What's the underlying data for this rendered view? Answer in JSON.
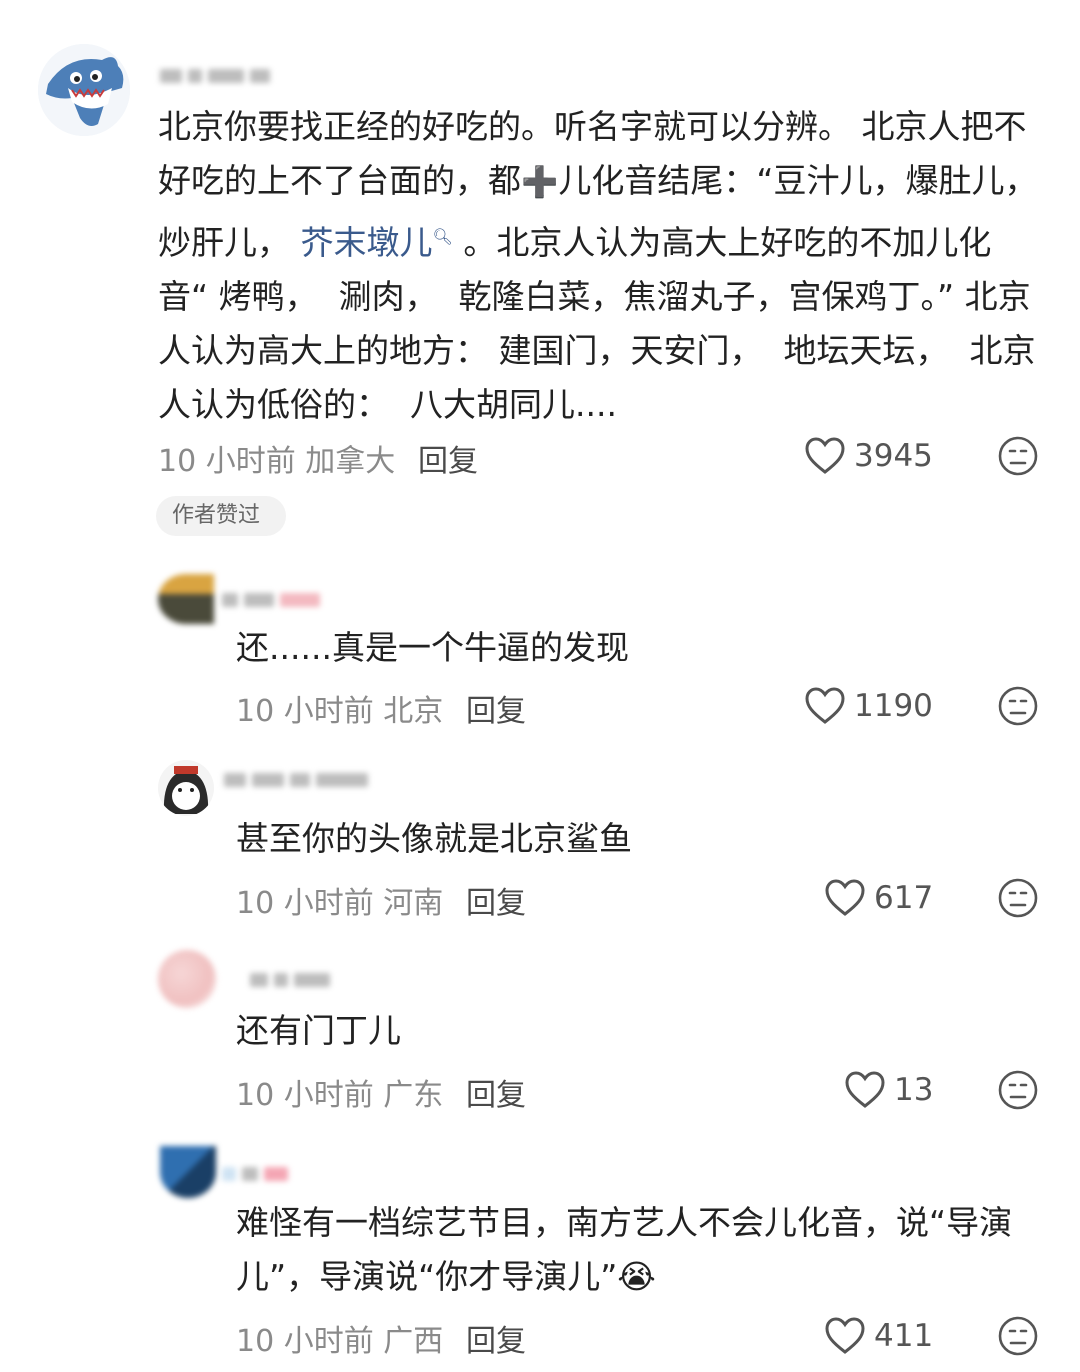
{
  "main_comment": {
    "author_name": "",
    "text_part1": "北京你要找正经的好吃的。听名字就可以分辨。 北京人把不好吃的上不了台面的，都",
    "plus_glyph": "➕",
    "text_part2": "儿化音结尾：“豆汁儿，爆肚儿，炒肝儿，",
    "link_text": "芥末墩儿",
    "text_part3": "。北京人认为高大上好吃的不加儿化音“ 烤鸭，  涮肉，  乾隆白菜，焦溜丸子，宫保鸡丁。” 北京人认为高大上的地方： 建国门，天安门，  地坛天坛，  北京人认为低俗的：  八大胡同儿....",
    "time": "10 小时前",
    "location": "加拿大",
    "reply_label": "回复",
    "likes": "3945",
    "badge": "作者赞过"
  },
  "replies": [
    {
      "text": "还......真是一个牛逼的发现",
      "time": "10 小时前",
      "location": "北京",
      "reply_label": "回复",
      "likes": "1190"
    },
    {
      "text": "甚至你的头像就是北京鲨鱼",
      "time": "10 小时前",
      "location": "河南",
      "reply_label": "回复",
      "likes": "617"
    },
    {
      "text": "还有门丁儿",
      "time": "10 小时前",
      "location": "广东",
      "reply_label": "回复",
      "likes": "13"
    },
    {
      "text": "难怪有一档综艺节目，南方艺人不会儿化音，说“导演儿”，导演说“你才导演儿”",
      "emoji": "😭",
      "time": "10 小时前",
      "location": "广西",
      "reply_label": "回复",
      "likes": "411"
    }
  ],
  "icons": {
    "like": "heart-outline-icon",
    "dislike": "meh-face-icon",
    "search": "search-icon"
  },
  "colors": {
    "text": "#222222",
    "meta": "#8a8a8a",
    "link": "#3a5a8c",
    "badge_bg": "#f2f2f2"
  }
}
